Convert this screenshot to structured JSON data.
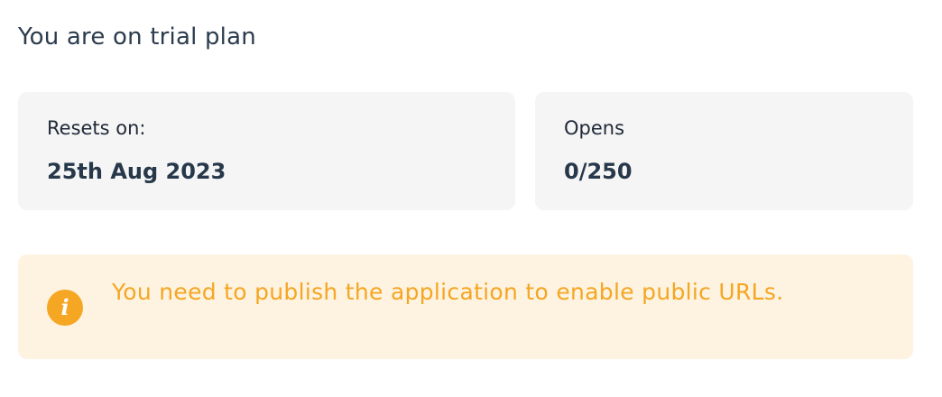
{
  "plan": {
    "title": "You are on trial plan"
  },
  "stats": {
    "resets": {
      "label": "Resets on:",
      "value": "25th Aug 2023"
    },
    "opens": {
      "label": "Opens",
      "value": "0/250"
    }
  },
  "notice": {
    "icon": "info-icon",
    "icon_glyph": "i",
    "text": "You need to publish the application to enable public URLs.",
    "color": "#f5a623",
    "background": "#fdf3e0"
  },
  "colors": {
    "card_background": "#f5f5f5",
    "heading_text": "#2b3c4e"
  }
}
